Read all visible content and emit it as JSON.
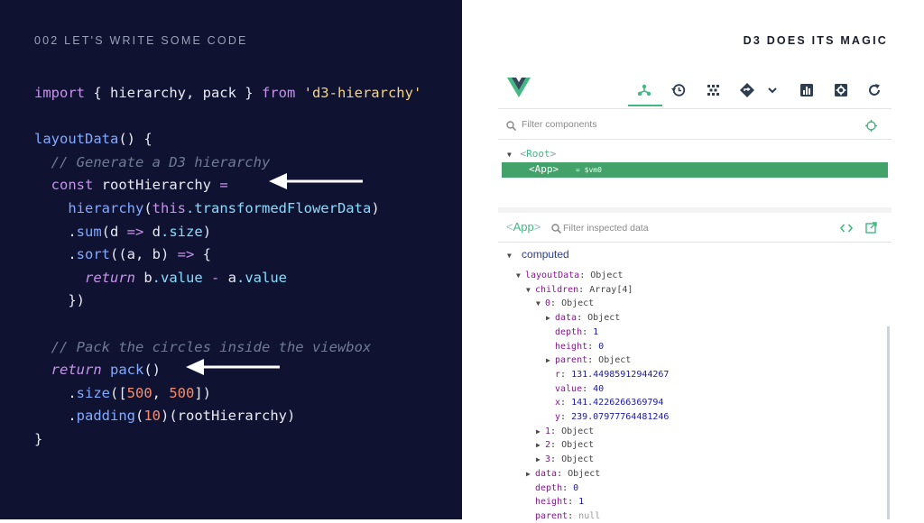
{
  "left": {
    "section_label": "002 LET'S WRITE SOME CODE",
    "code_lines": [
      [
        {
          "t": "import ",
          "c": "k"
        },
        {
          "t": "{ hierarchy, pack } ",
          "c": ""
        },
        {
          "t": "from ",
          "c": "k"
        },
        {
          "t": "'d3-hierarchy'",
          "c": "str"
        }
      ],
      [],
      [
        {
          "t": "layoutData",
          "c": "fn"
        },
        {
          "t": "() {",
          "c": ""
        }
      ],
      [
        {
          "t": "  // Generate a D3 hierarchy",
          "c": "cm"
        }
      ],
      [
        {
          "t": "  ",
          "c": ""
        },
        {
          "t": "const ",
          "c": "k"
        },
        {
          "t": "rootHierarchy ",
          "c": ""
        },
        {
          "t": "=",
          "c": "op"
        }
      ],
      [
        {
          "t": "    ",
          "c": ""
        },
        {
          "t": "hierarchy",
          "c": "fn"
        },
        {
          "t": "(",
          "c": ""
        },
        {
          "t": "this",
          "c": "k"
        },
        {
          "t": ".transformedFlowerData",
          "c": "pr"
        },
        {
          "t": ")",
          "c": ""
        }
      ],
      [
        {
          "t": "    .",
          "c": ""
        },
        {
          "t": "sum",
          "c": "fn"
        },
        {
          "t": "(d ",
          "c": ""
        },
        {
          "t": "=>",
          "c": "op"
        },
        {
          "t": " d",
          "c": ""
        },
        {
          "t": ".size",
          "c": "pr"
        },
        {
          "t": ")",
          "c": ""
        }
      ],
      [
        {
          "t": "    .",
          "c": ""
        },
        {
          "t": "sort",
          "c": "fn"
        },
        {
          "t": "((a, b) ",
          "c": ""
        },
        {
          "t": "=>",
          "c": "op"
        },
        {
          "t": " {",
          "c": ""
        }
      ],
      [
        {
          "t": "      ",
          "c": ""
        },
        {
          "t": "return",
          "c": "k it"
        },
        {
          "t": " b",
          "c": ""
        },
        {
          "t": ".value",
          "c": "pr"
        },
        {
          "t": " - ",
          "c": "op"
        },
        {
          "t": "a",
          "c": ""
        },
        {
          "t": ".value",
          "c": "pr"
        }
      ],
      [
        {
          "t": "    })",
          "c": ""
        }
      ],
      [],
      [
        {
          "t": "  // Pack the circles inside the viewbox",
          "c": "cm"
        }
      ],
      [
        {
          "t": "  ",
          "c": ""
        },
        {
          "t": "return",
          "c": "k it"
        },
        {
          "t": " ",
          "c": ""
        },
        {
          "t": "pack",
          "c": "fn"
        },
        {
          "t": "()",
          "c": ""
        }
      ],
      [
        {
          "t": "    .",
          "c": ""
        },
        {
          "t": "size",
          "c": "fn"
        },
        {
          "t": "([",
          "c": ""
        },
        {
          "t": "500",
          "c": "num"
        },
        {
          "t": ", ",
          "c": ""
        },
        {
          "t": "500",
          "c": "num"
        },
        {
          "t": "])",
          "c": ""
        }
      ],
      [
        {
          "t": "    .",
          "c": ""
        },
        {
          "t": "padding",
          "c": "fn"
        },
        {
          "t": "(",
          "c": ""
        },
        {
          "t": "10",
          "c": "num"
        },
        {
          "t": ")(rootHierarchy)",
          "c": ""
        }
      ],
      [
        {
          "t": "}",
          "c": ""
        }
      ]
    ]
  },
  "right": {
    "title": "D3 DOES ITS MAGIC",
    "devtools": {
      "toolbar_icons": [
        "components-icon",
        "history-icon",
        "vuex-icon",
        "router-icon",
        "chevron-down-icon",
        "performance-icon",
        "settings-icon",
        "refresh-icon"
      ],
      "filter_components_placeholder": "Filter components",
      "tree": {
        "root_open": "<",
        "root_name": "Root",
        "root_close": ">",
        "app_label": "<App>",
        "app_vm": "= $vm0"
      },
      "inspector": {
        "component_name": "App",
        "filter_placeholder": "Filter inspected data",
        "section": "computed"
      },
      "props": [
        {
          "indent": 0,
          "tri": "▼",
          "key": "layoutData",
          "value": "Object",
          "vtype": "obj"
        },
        {
          "indent": 1,
          "tri": "▼",
          "key": "children",
          "value": "Array[4]",
          "vtype": "obj"
        },
        {
          "indent": 2,
          "tri": "▼",
          "key": "0",
          "value": "Object",
          "vtype": "obj"
        },
        {
          "indent": 3,
          "tri": "▶",
          "key": "data",
          "value": "Object",
          "vtype": "obj"
        },
        {
          "indent": 3,
          "tri": "",
          "key": "depth",
          "value": "1",
          "vtype": "nv"
        },
        {
          "indent": 3,
          "tri": "",
          "key": "height",
          "value": "0",
          "vtype": "nv"
        },
        {
          "indent": 3,
          "tri": "▶",
          "key": "parent",
          "value": "Object",
          "vtype": "obj"
        },
        {
          "indent": 3,
          "tri": "",
          "key": "r",
          "value": "131.44985912944267",
          "vtype": "nv"
        },
        {
          "indent": 3,
          "tri": "",
          "key": "value",
          "value": "40",
          "vtype": "nv"
        },
        {
          "indent": 3,
          "tri": "",
          "key": "x",
          "value": "141.4226266369794",
          "vtype": "nv"
        },
        {
          "indent": 3,
          "tri": "",
          "key": "y",
          "value": "239.07977764481246",
          "vtype": "nv"
        },
        {
          "indent": 2,
          "tri": "▶",
          "key": "1",
          "value": "Object",
          "vtype": "obj"
        },
        {
          "indent": 2,
          "tri": "▶",
          "key": "2",
          "value": "Object",
          "vtype": "obj"
        },
        {
          "indent": 2,
          "tri": "▶",
          "key": "3",
          "value": "Object",
          "vtype": "obj"
        },
        {
          "indent": 1,
          "tri": "▶",
          "key": "data",
          "value": "Object",
          "vtype": "obj"
        },
        {
          "indent": 1,
          "tri": "",
          "key": "depth",
          "value": "0",
          "vtype": "nv"
        },
        {
          "indent": 1,
          "tri": "",
          "key": "height",
          "value": "1",
          "vtype": "nv"
        },
        {
          "indent": 1,
          "tri": "",
          "key": "parent",
          "value": "null",
          "vtype": "nullv"
        }
      ]
    }
  },
  "colors": {
    "left_bg": "#0f1331",
    "vue_green": "#42b883",
    "selected_row": "#42a26a"
  }
}
